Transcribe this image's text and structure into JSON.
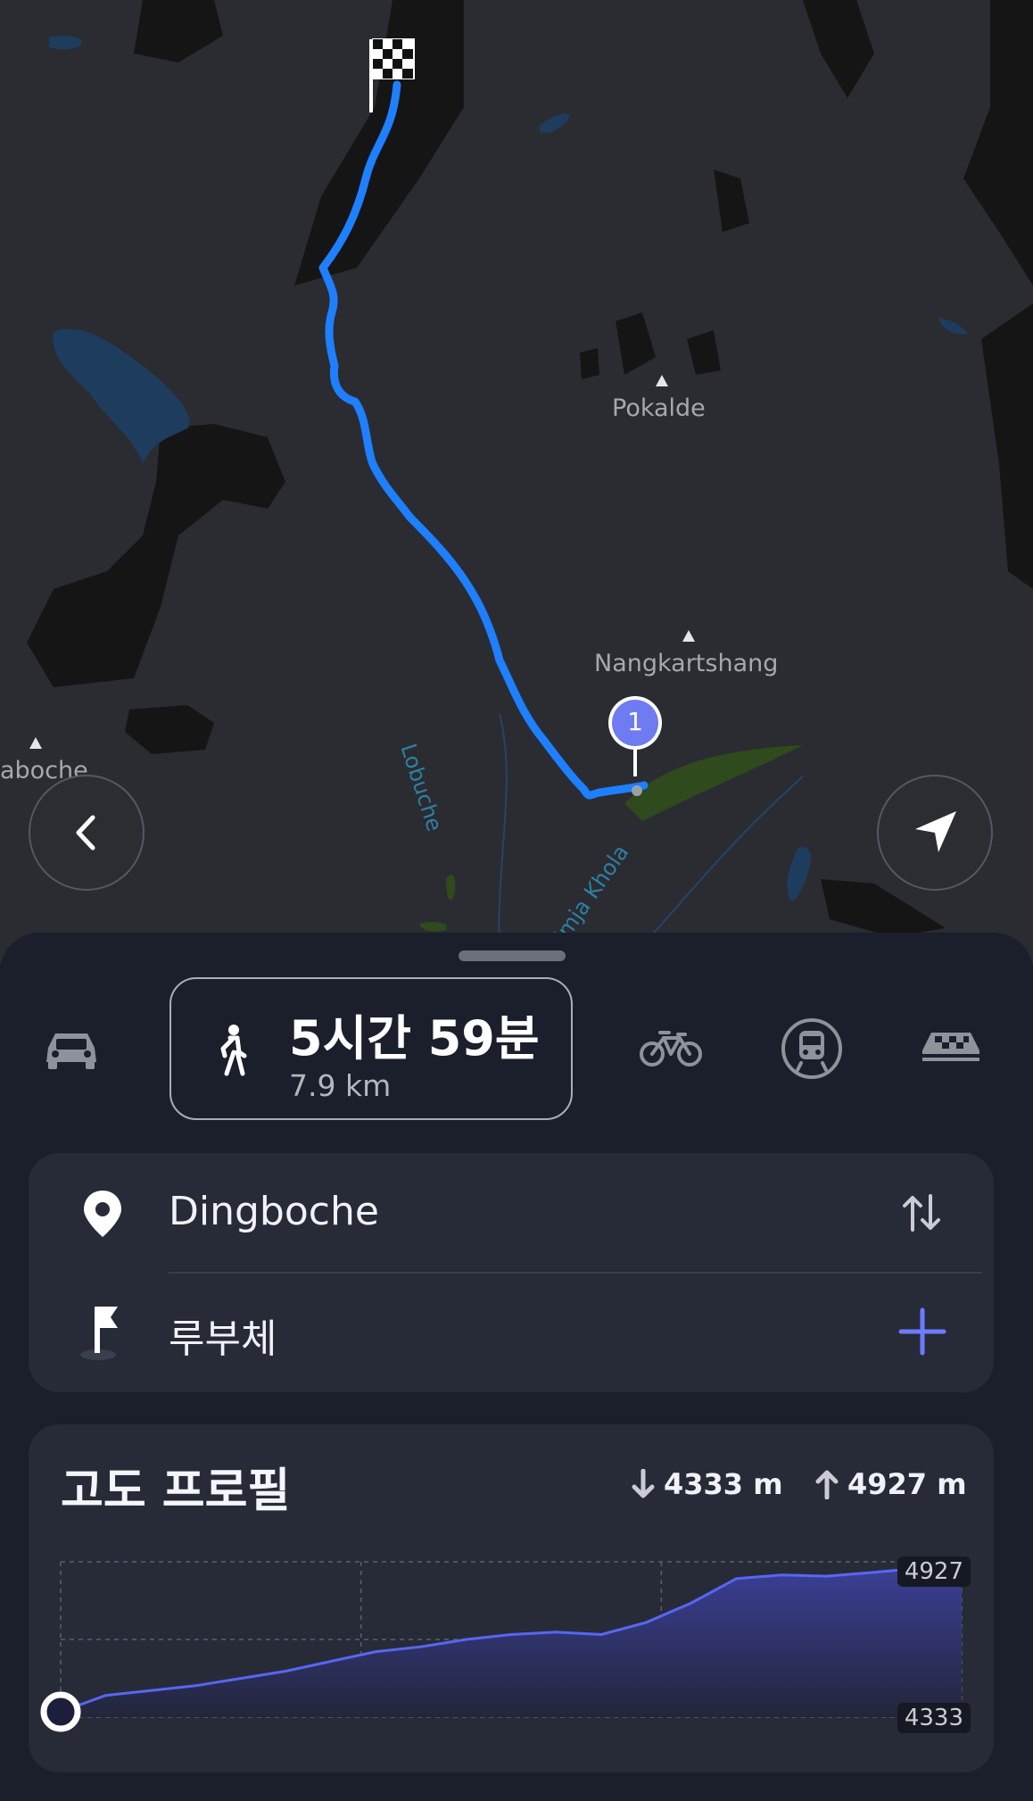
{
  "map": {
    "labels": {
      "pokalde": "Pokalde",
      "nangkartshang": "Nangkartshang",
      "left_village": "aboche",
      "river_lobuche": "Lobuche",
      "river_imja": "Imja Khola"
    },
    "waypoint_number": "1",
    "colors": {
      "route": "#1e7fff",
      "waypoint": "#6f7bf0",
      "water": "#1e3d5e",
      "rock": "#151515",
      "vegetation": "#2f4a1c"
    },
    "icons": {
      "finish": "checkered-flag-icon",
      "back": "chevron-left-icon",
      "locate": "navigation-arrow-icon"
    }
  },
  "transport_modes": {
    "car": "car-icon",
    "walk": "walking-person-icon",
    "bike": "bicycle-icon",
    "transit": "train-icon",
    "taxi": "taxi-icon",
    "selected": "walk"
  },
  "walk_summary": {
    "duration": "5시간 59분",
    "distance": "7.9 km"
  },
  "route": {
    "origin": "Dingboche",
    "destination": "루부체",
    "swap_icon": "swap-arrows-icon",
    "add_icon": "plus-icon",
    "accent": "#6b7cff"
  },
  "elevation": {
    "title": "고도 프로필",
    "descent_label": "4333 m",
    "ascent_label": "4927 m",
    "y_max_label": "4927",
    "y_min_label": "4333"
  },
  "chart_data": {
    "type": "area",
    "title": "고도 프로필",
    "xlabel": "",
    "ylabel": "",
    "ylim": [
      4333,
      4927
    ],
    "x": [
      0,
      0.05,
      0.1,
      0.15,
      0.2,
      0.25,
      0.3,
      0.35,
      0.4,
      0.45,
      0.5,
      0.55,
      0.6,
      0.65,
      0.7,
      0.75,
      0.8,
      0.85,
      0.9,
      0.95,
      1.0
    ],
    "series": [
      {
        "values": [
          4333,
          4400,
          4420,
          4440,
          4470,
          4500,
          4540,
          4580,
          4600,
          4630,
          4650,
          4660,
          4650,
          4700,
          4780,
          4880,
          4895,
          4890,
          4905,
          4922,
          4927
        ]
      }
    ],
    "grid": true
  }
}
